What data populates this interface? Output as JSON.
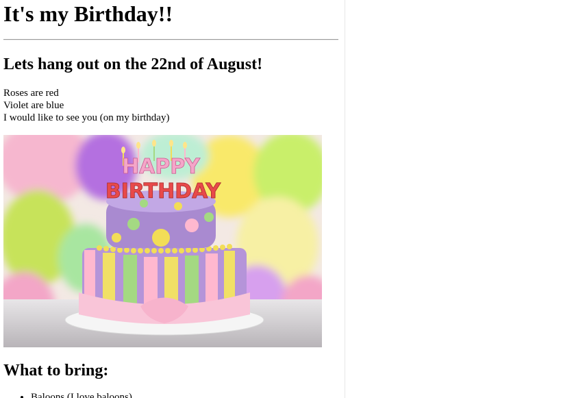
{
  "page": {
    "title": "It's my Birthday!!",
    "subtitle": "Lets hang out on the 22nd of August!",
    "poem": [
      "Roses are red",
      "Violet are blue",
      "I would like to see you (on my birthday)"
    ],
    "image": {
      "cake_text_line1": "HAPPY",
      "cake_text_line2": "BIRTHDAY"
    },
    "bring_heading": "What to bring:",
    "bring_items": [
      "Baloons (I love baloons)"
    ]
  },
  "colors": {
    "text": "#000000",
    "rule": "#9a9a9a",
    "background": "#ffffff"
  }
}
